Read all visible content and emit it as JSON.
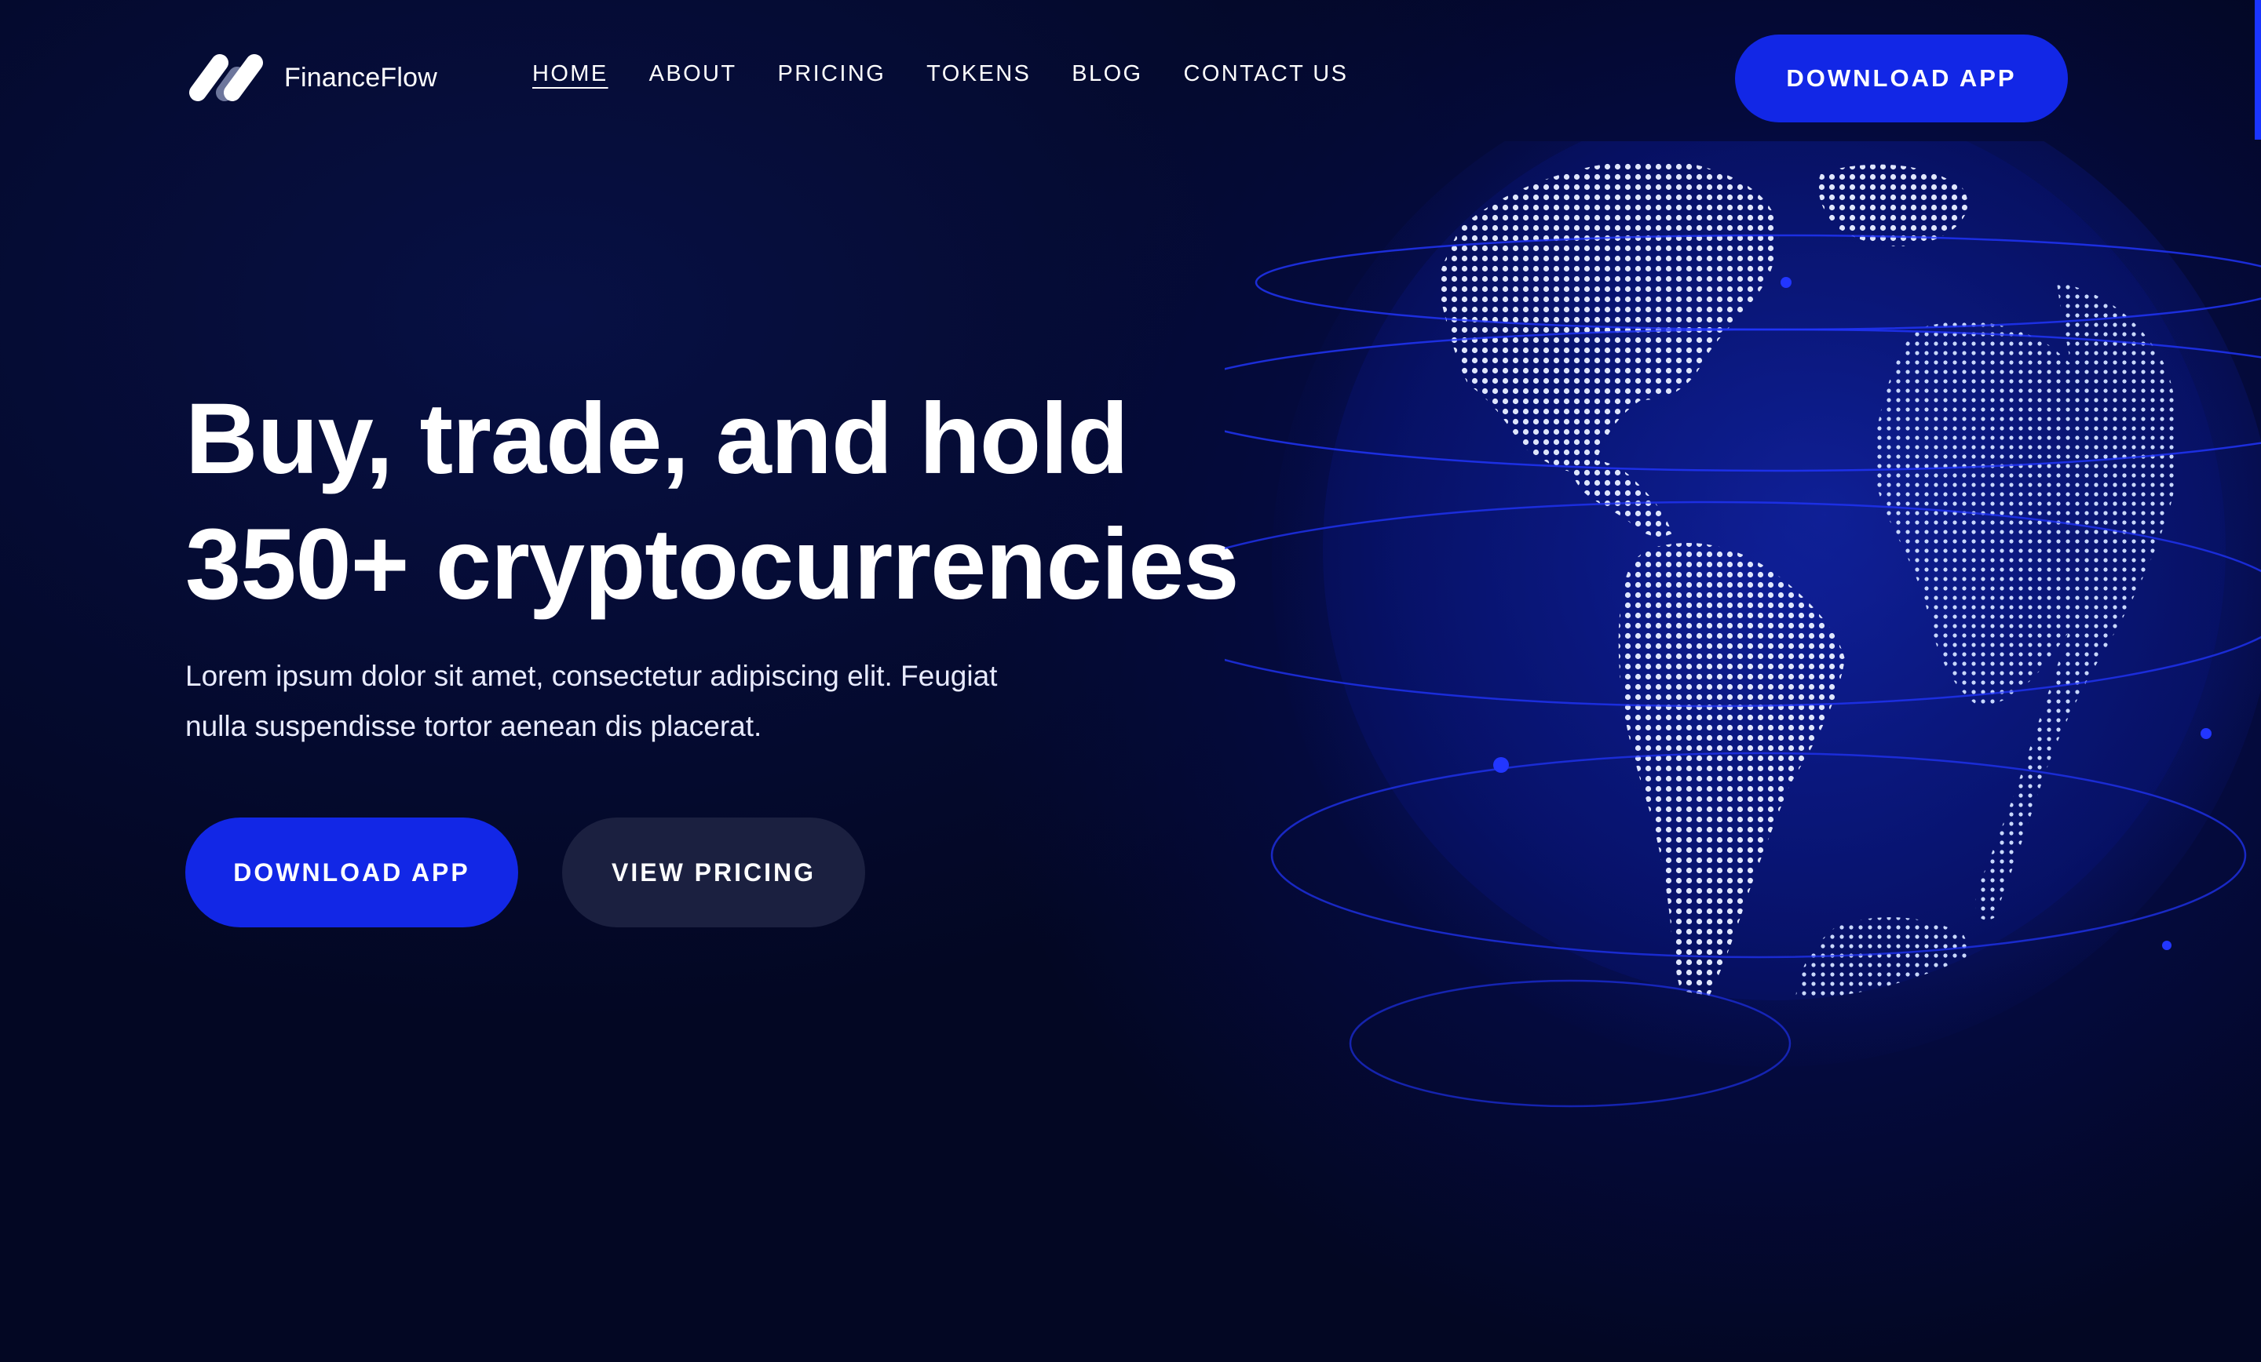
{
  "header": {
    "logo_text": "FinanceFlow",
    "nav": [
      {
        "label": "HOME",
        "active": true
      },
      {
        "label": "ABOUT",
        "active": false
      },
      {
        "label": "PRICING",
        "active": false
      },
      {
        "label": "TOKENS",
        "active": false
      },
      {
        "label": "BLOG",
        "active": false
      },
      {
        "label": "CONTACT US",
        "active": false
      }
    ],
    "cta_label": "DOWNLOAD APP"
  },
  "hero": {
    "headline_line1": "Buy, trade, and hold",
    "headline_line2": "350+ cryptocurrencies",
    "subtext": "Lorem ipsum dolor sit amet, consectetur adipiscing elit. Feugiat nulla suspendisse tortor aenean dis placerat.",
    "primary_cta": "DOWNLOAD APP",
    "secondary_cta": "VIEW PRICING"
  },
  "icons": {
    "logo": "financeflow-logo-icon",
    "globe": "dotted-world-globe-illustration"
  },
  "colors": {
    "background": "#030723",
    "accent": "#1227e6",
    "secondary_button": "#1b2040",
    "text": "#ffffff"
  }
}
